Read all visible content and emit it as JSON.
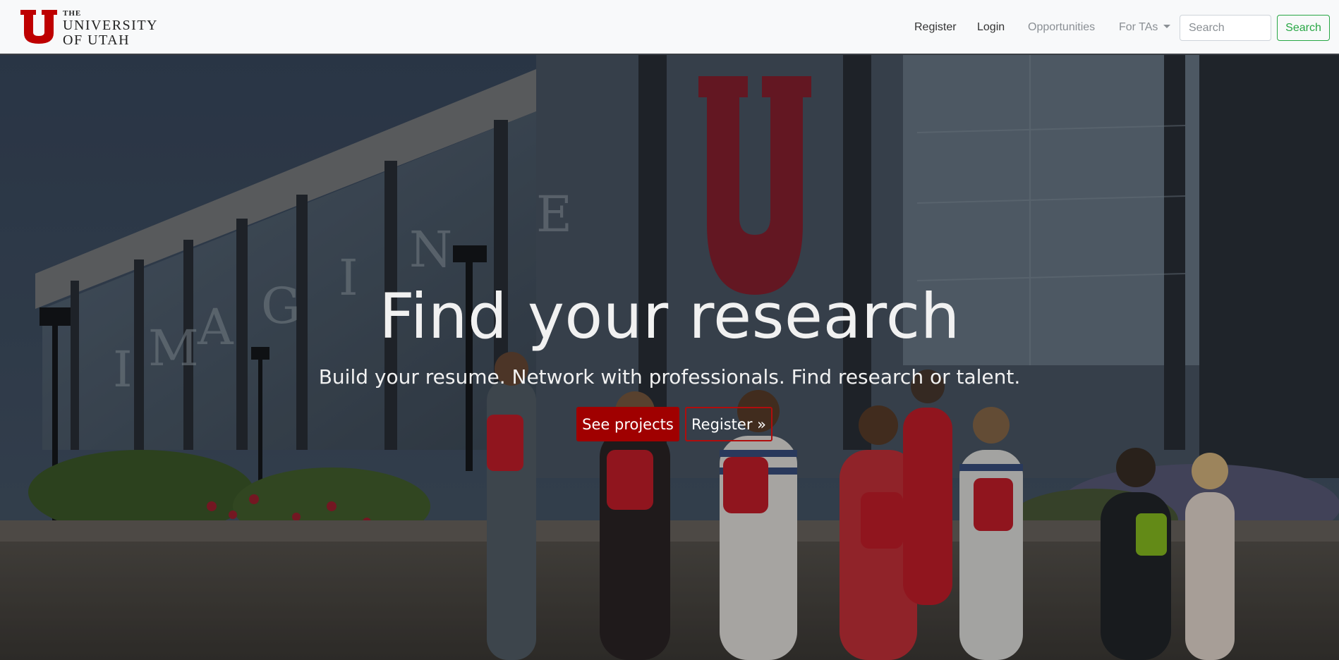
{
  "brand": {
    "the": "THE",
    "line1": "UNIVERSITY",
    "line2": "OF UTAH",
    "color": "#be0000"
  },
  "nav": {
    "register": "Register",
    "login": "Login",
    "opportunities": "Opportunities",
    "for_tas": "For TAs"
  },
  "search": {
    "placeholder": "Search",
    "button": "Search"
  },
  "hero": {
    "title": "Find your research",
    "subtitle": "Build your resume. Network with professionals. Find research or talent.",
    "primary_button": "See projects",
    "secondary_button": "Register »",
    "building_letters": "IMAGINE"
  },
  "colors": {
    "accent_red": "#a00000",
    "search_green": "#28a745"
  }
}
